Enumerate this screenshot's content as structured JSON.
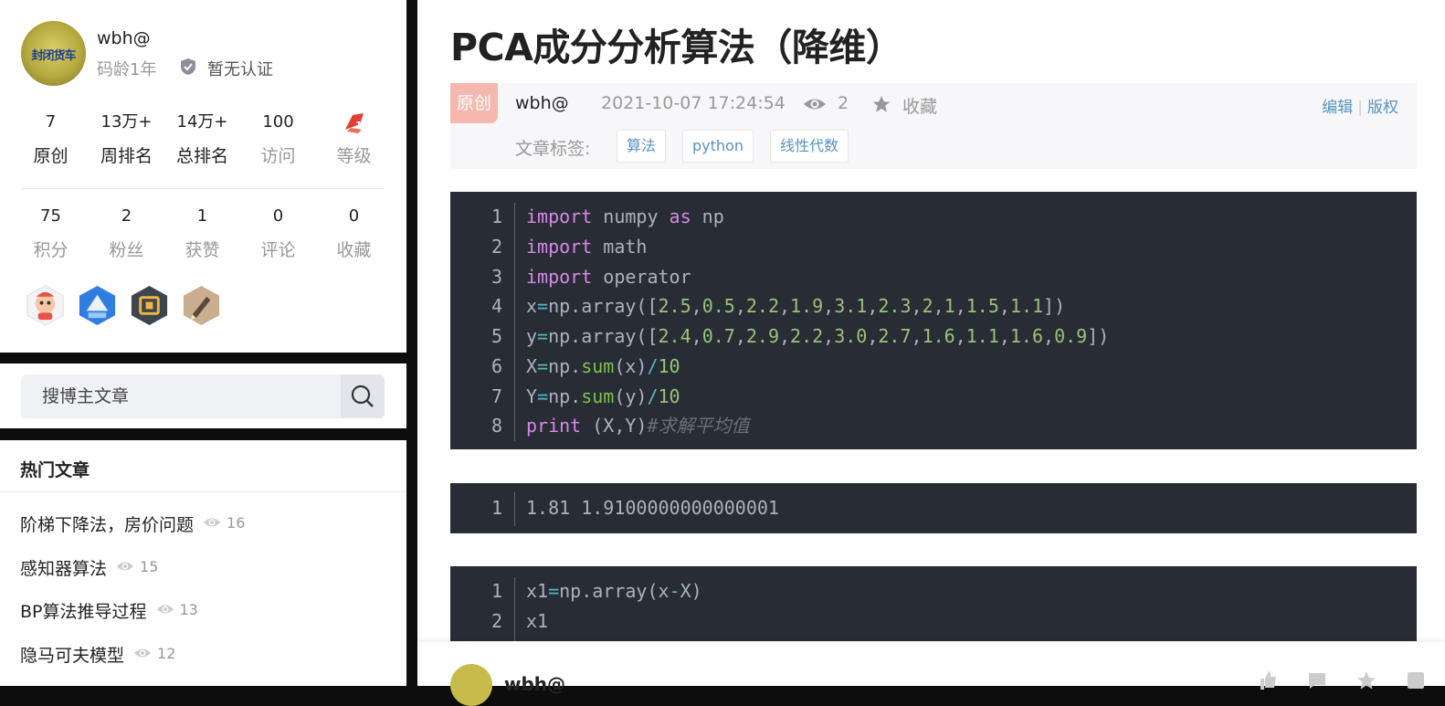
{
  "profile": {
    "avatar_text": "封闭货车",
    "username": "wbh@",
    "code_age": "码龄1年",
    "cert": "暂无认证",
    "stats_row1": [
      {
        "num": "7",
        "label": "原创"
      },
      {
        "num": "13万+",
        "label": "周排名"
      },
      {
        "num": "14万+",
        "label": "总排名"
      },
      {
        "num": "100",
        "label": "访问"
      },
      {
        "num": "",
        "label": "等级"
      }
    ],
    "stats_row2": [
      {
        "num": "75",
        "label": "积分"
      },
      {
        "num": "2",
        "label": "粉丝"
      },
      {
        "num": "1",
        "label": "获赞"
      },
      {
        "num": "0",
        "label": "评论"
      },
      {
        "num": "0",
        "label": "收藏"
      }
    ],
    "badges": [
      "monkey-badge-icon",
      "blue-shield-badge-icon",
      "hexagon-badge-icon",
      "pen-badge-icon"
    ],
    "level_icon": "level-1-icon",
    "accent": "#e33e33"
  },
  "search": {
    "placeholder": "搜博主文章"
  },
  "hot": {
    "title": "热门文章",
    "items": [
      {
        "title": "阶梯下降法，房价问题",
        "views": "16"
      },
      {
        "title": "感知器算法",
        "views": "15"
      },
      {
        "title": "BP算法推导过程",
        "views": "13"
      },
      {
        "title": "隐马可夫模型",
        "views": "12"
      }
    ]
  },
  "article": {
    "title": "PCA成分分析算法（降维）",
    "orig_tag": "原创",
    "author": "wbh@",
    "date": "2021-10-07 17:24:54",
    "views": "2",
    "fav": "收藏",
    "edit": "编辑",
    "copyright": "版权",
    "tag_label": "文章标签:",
    "tags": [
      "算法",
      "python",
      "线性代数"
    ]
  },
  "code_blocks": {
    "block1": {
      "line_numbers": [
        "1",
        "2",
        "3",
        "4",
        "5",
        "6",
        "7",
        "8"
      ]
    },
    "block2": {
      "line_numbers": [
        "1"
      ],
      "output": "1.81 1.9100000000000001"
    },
    "block3": {
      "line_numbers": [
        "1",
        "2"
      ]
    }
  },
  "footer": {
    "author": "wbh@"
  }
}
